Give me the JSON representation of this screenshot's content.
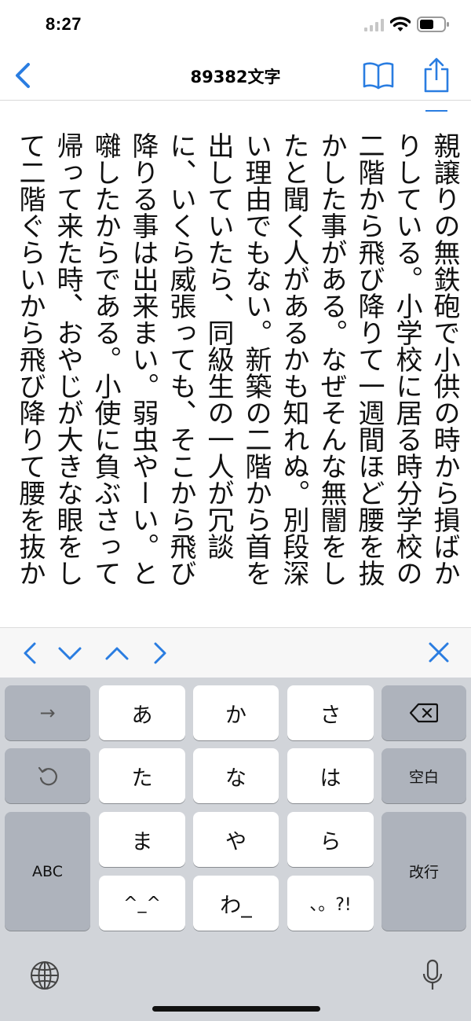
{
  "status_bar": {
    "time": "8:27"
  },
  "nav": {
    "title": "89382文字"
  },
  "document": {
    "text": "親譲りの無鉄砲で小供の時から損ばかりしている。小学校に居る時分学校の二階から飛び降りて一週間ほど腰を抜かした事がある。なぜそんな無闇をしたと聞く人があるかも知れぬ。別段深い理由でもない。新築の二階から首を出していたら、同級生の一人が冗談に、いくら威張っても、そこから飛び降りる事は出来まい。弱虫やーい。と囃したからである。小使に負ぶさって帰って来た時、おやじが大きな眼をして二階ぐらいから飛び降りて腰を抜か"
  },
  "keyboard": {
    "row1": [
      "→",
      "あ",
      "か",
      "さ",
      "⌫"
    ],
    "row2": [
      "↺",
      "た",
      "な",
      "は",
      "空白"
    ],
    "row3": [
      "ABC",
      "ま",
      "や",
      "ら",
      "改行"
    ],
    "row4": [
      "^^",
      "わ",
      "、。?!"
    ],
    "labels": {
      "arrow": "→",
      "a": "あ",
      "ka": "か",
      "sa": "さ",
      "ta": "た",
      "na": "な",
      "ha": "は",
      "space": "空白",
      "abc": "ABC",
      "ma": "ま",
      "ya": "や",
      "ra": "ら",
      "return": "改行",
      "kaomoji": "^_^",
      "wa": "わ_",
      "punct": "、。?!"
    }
  },
  "icons": {
    "accent": "#2a7de1"
  }
}
